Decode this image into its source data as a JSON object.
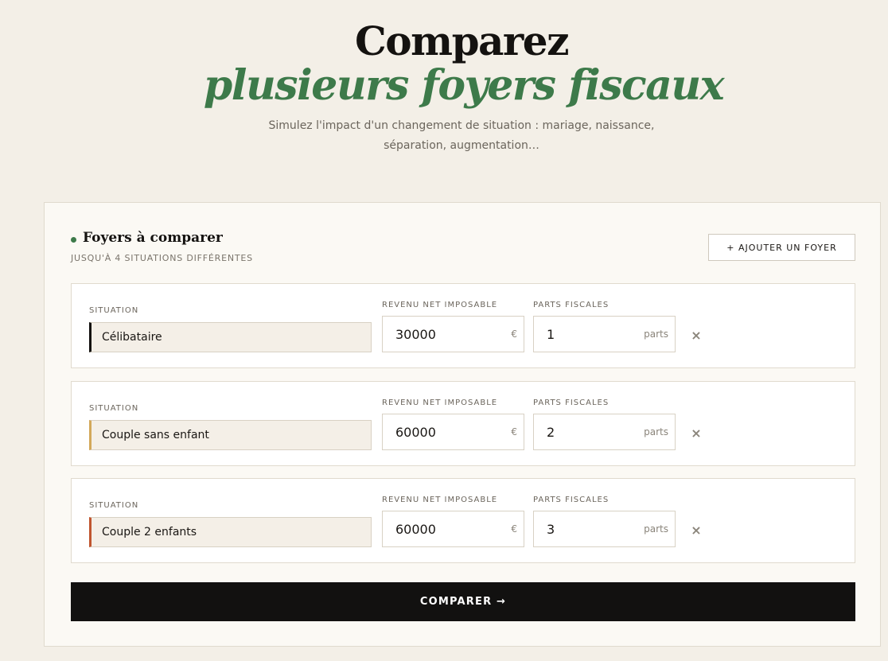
{
  "hero": {
    "title": "Comparez",
    "title_em": "plusieurs foyers fiscaux",
    "subtitle": "Simulez l'impact d'un changement de situation : mariage, naissance, séparation, augmentation…"
  },
  "card": {
    "title": "Foyers à comparer",
    "kicker": "JUSQU'À 4 SITUATIONS DIFFÉRENTES",
    "add_button": "+ AJOUTER UN FOYER",
    "label_situation": "SITUATION",
    "label_revenu": "REVENU NET IMPOSABLE",
    "label_parts": "PARTS FISCALES",
    "unit_revenu": "€",
    "unit_parts": "parts",
    "remove_icon": "×",
    "accent_dot_color": "#3d7a4a"
  },
  "foyers": [
    {
      "situation": "Célibataire",
      "revenu": "30000",
      "parts": "1",
      "accent": "#141210"
    },
    {
      "situation": "Couple sans enfant",
      "revenu": "60000",
      "parts": "2",
      "accent": "#d3a85a"
    },
    {
      "situation": "Couple 2 enfants",
      "revenu": "60000",
      "parts": "3",
      "accent": "#c0552f"
    }
  ],
  "compare_button": "COMPARER →"
}
